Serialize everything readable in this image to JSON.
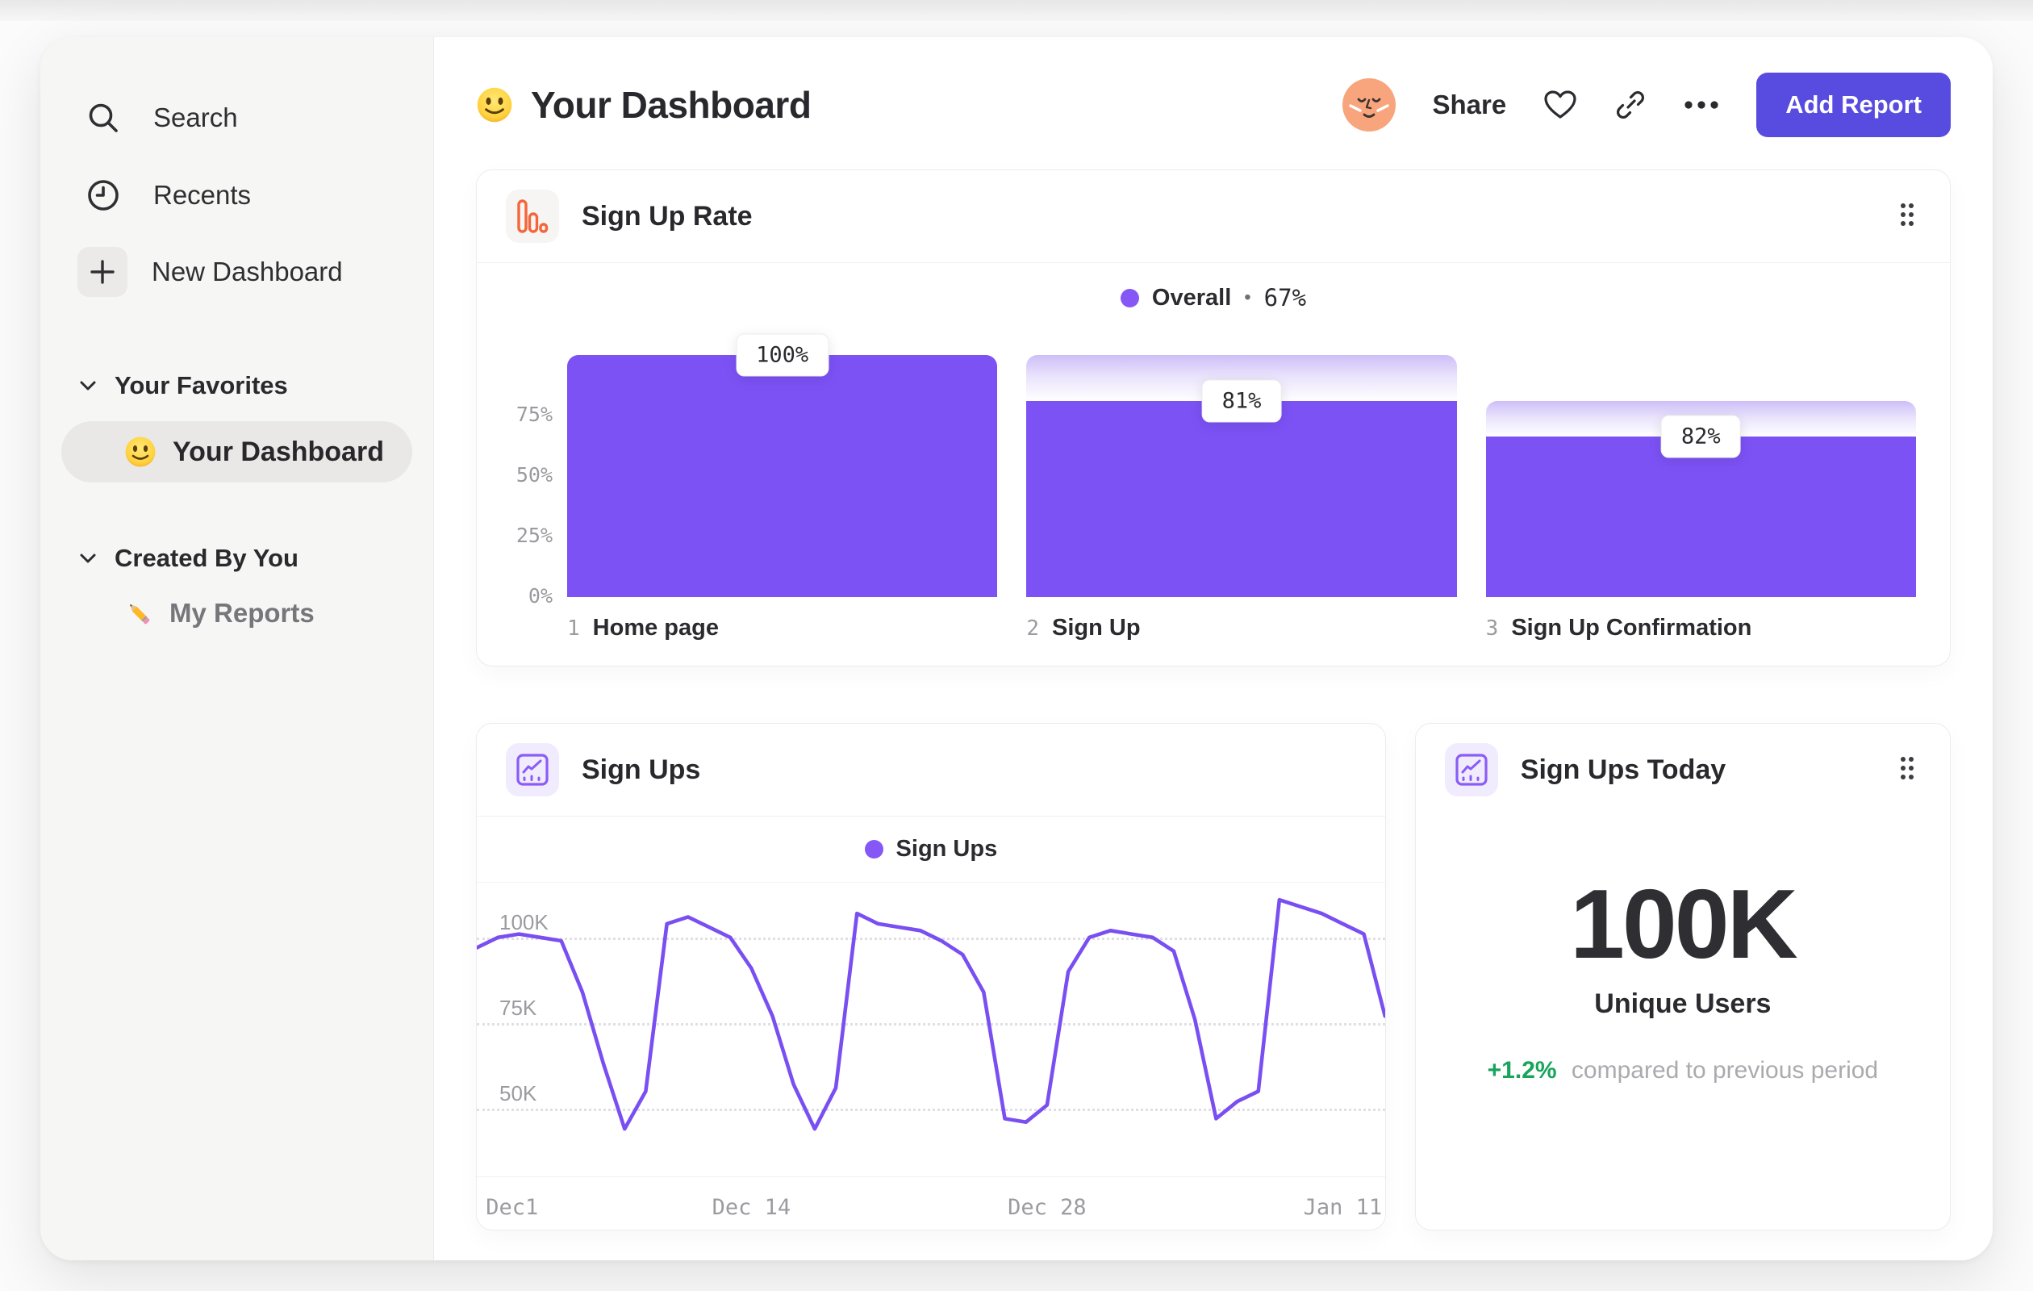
{
  "sidebar": {
    "nav": [
      {
        "label": "Search"
      },
      {
        "label": "Recents"
      },
      {
        "label": "New Dashboard"
      }
    ],
    "sections": [
      {
        "label": "Your Favorites"
      },
      {
        "label": "Created By You"
      }
    ],
    "favorites_item": {
      "label": "Your Dashboard",
      "selected": true
    },
    "created_item": {
      "label": "My Reports"
    }
  },
  "header": {
    "title": "Your Dashboard",
    "share": "Share",
    "add_report": "Add Report"
  },
  "kpi": {
    "title": "Sign Ups Today",
    "value": "100K",
    "label": "Unique Users",
    "delta": "+1.2%",
    "delta_note": "compared to previous period"
  },
  "colors": {
    "accent_purple": "#7c52f5",
    "legend_dot_purple": "#8557f6",
    "button_purple": "#584ce0",
    "icon_orange": "#f4663b",
    "positive_green": "#17a45b"
  },
  "chart_data": [
    {
      "type": "bar",
      "variant": "funnel",
      "title": "Sign Up Rate",
      "legend": {
        "series": "Overall",
        "separator": "•",
        "value": "67%"
      },
      "categories": [
        "Home page",
        "Sign Up",
        "Sign Up Confirmation"
      ],
      "step_numbers": [
        "1",
        "2",
        "3"
      ],
      "step_conversion_labels": [
        "100%",
        "81%",
        "82%"
      ],
      "cumulative_pct": [
        100,
        81,
        66.4
      ],
      "previous_step_pct": [
        100,
        100,
        81
      ],
      "y_ticks": [
        {
          "label": "75%",
          "value": 75
        },
        {
          "label": "50%",
          "value": 50
        },
        {
          "label": "25%",
          "value": 25
        },
        {
          "label": "0%",
          "value": 0
        }
      ],
      "ylim": [
        0,
        100
      ],
      "bar_color": "#7c52f5",
      "legend_position": "top-center"
    },
    {
      "type": "line",
      "title": "Sign Ups",
      "legend": "Sign Ups",
      "x_ticks": [
        {
          "label": "Dec1",
          "index": 0
        },
        {
          "label": "Dec 14",
          "index": 13
        },
        {
          "label": "Dec 28",
          "index": 27
        },
        {
          "label": "Jan 11",
          "index": 41
        }
      ],
      "y_ticks": [
        {
          "label": "100K",
          "value": 100
        },
        {
          "label": "75K",
          "value": 75
        },
        {
          "label": "50K",
          "value": 50
        }
      ],
      "values_thousands": [
        97,
        100,
        101,
        100,
        99,
        84,
        63,
        44,
        55,
        104,
        106,
        103,
        100,
        91,
        77,
        57,
        44,
        56,
        107,
        104,
        103,
        102,
        99,
        95,
        84,
        47,
        46,
        51,
        90,
        100,
        102,
        101,
        100,
        96,
        76,
        47,
        52,
        55,
        111,
        109,
        107,
        104,
        101,
        77
      ],
      "ylim_thousands": [
        32,
        116
      ],
      "line_color": "#7a4ff2",
      "grid": "dotted-horizontal",
      "legend_position": "top-center"
    }
  ]
}
